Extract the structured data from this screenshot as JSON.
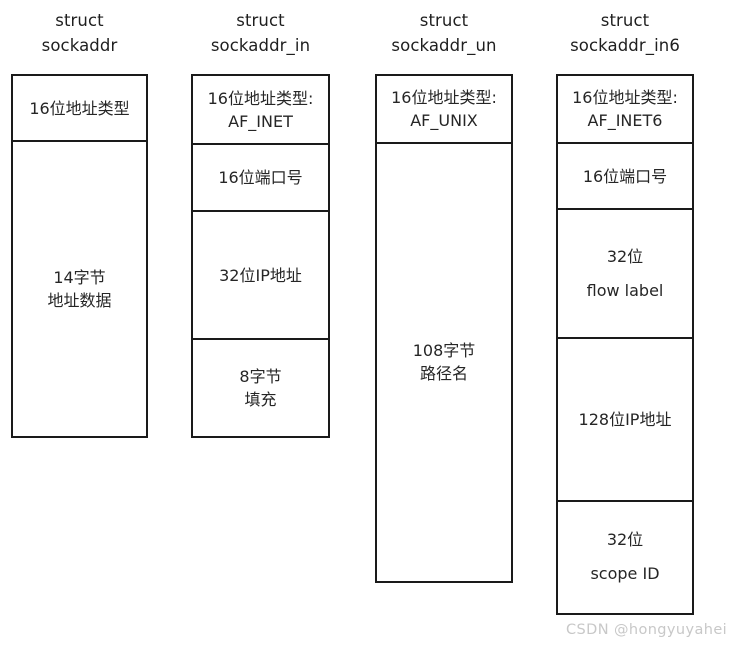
{
  "diagram": {
    "title_prefix": "struct",
    "columns": [
      {
        "id": "sockaddr",
        "title": "struct\nsockaddr",
        "title_line1": "struct",
        "title_line2": "sockaddr",
        "fields": [
          {
            "id": "addr-family",
            "lines": [
              "16位地址类型"
            ]
          },
          {
            "id": "addr-data",
            "lines": [
              "14字节",
              "地址数据"
            ]
          }
        ]
      },
      {
        "id": "sockaddr_in",
        "title": "struct\nsockaddr_in",
        "title_line1": "struct",
        "title_line2": "sockaddr_in",
        "fields": [
          {
            "id": "addr-family",
            "lines": [
              "16位地址类型:",
              "AF_INET"
            ]
          },
          {
            "id": "port",
            "lines": [
              "16位端口号"
            ]
          },
          {
            "id": "ip-address",
            "lines": [
              "32位IP地址"
            ]
          },
          {
            "id": "padding",
            "lines": [
              "8字节",
              "填充"
            ]
          }
        ]
      },
      {
        "id": "sockaddr_un",
        "title": "struct\nsockaddr_un",
        "title_line1": "struct",
        "title_line2": "sockaddr_un",
        "fields": [
          {
            "id": "addr-family",
            "lines": [
              "16位地址类型:",
              "AF_UNIX"
            ]
          },
          {
            "id": "pathname",
            "lines": [
              "108字节",
              "路径名"
            ]
          }
        ]
      },
      {
        "id": "sockaddr_in6",
        "title": "struct\nsockaddr_in6",
        "title_line1": "struct",
        "title_line2": "sockaddr_in6",
        "fields": [
          {
            "id": "addr-family",
            "lines": [
              "16位地址类型:",
              "AF_INET6"
            ]
          },
          {
            "id": "port",
            "lines": [
              "16位端口号"
            ]
          },
          {
            "id": "flow-label",
            "lines": [
              "32位",
              "flow label"
            ]
          },
          {
            "id": "ip-address",
            "lines": [
              "128位IP地址"
            ]
          },
          {
            "id": "scope-id",
            "lines": [
              "32位",
              "scope ID"
            ]
          }
        ]
      }
    ],
    "watermark": "CSDN @hongyuyahei",
    "colors": {
      "border": "#1a1a1a",
      "text": "#262626",
      "title": "#1f1f1f",
      "background": "#ffffff",
      "watermark": "#c8c8c8"
    }
  }
}
